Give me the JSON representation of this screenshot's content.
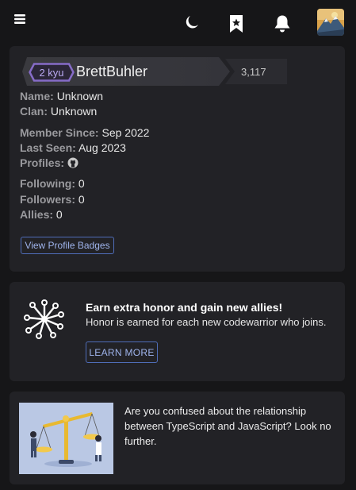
{
  "nav": {
    "icons": [
      "menu-icon",
      "moon-icon",
      "bookmark-star-icon",
      "bell-icon",
      "avatar"
    ]
  },
  "profile": {
    "rank": "2 kyu",
    "username": "BrettBuhler",
    "honor": "3,117",
    "fields": [
      {
        "label": "Name:",
        "value": "Unknown"
      },
      {
        "label": "Clan:",
        "value": "Unknown"
      },
      {
        "label": "Member Since:",
        "value": "Sep 2022"
      },
      {
        "label": "Last Seen:",
        "value": "Aug 2023"
      },
      {
        "label": "Profiles:",
        "value": ""
      },
      {
        "label": "Following:",
        "value": "0"
      },
      {
        "label": "Followers:",
        "value": "0"
      },
      {
        "label": "Allies:",
        "value": "0"
      }
    ],
    "badges_button": "View Profile Badges"
  },
  "promo": {
    "title": "Earn extra honor and gain new allies!",
    "text": "Honor is earned for each new codewarrior who joins.",
    "button": "LEARN MORE"
  },
  "article": {
    "text": "Are you confused about the relationship between TypeScript and JavaScript? Look no further."
  },
  "colors": {
    "background": "#161618",
    "card": "#222226",
    "rank": "#866cc7",
    "accent_border": "#4f6db8",
    "accent_text": "#9fb4ec"
  }
}
